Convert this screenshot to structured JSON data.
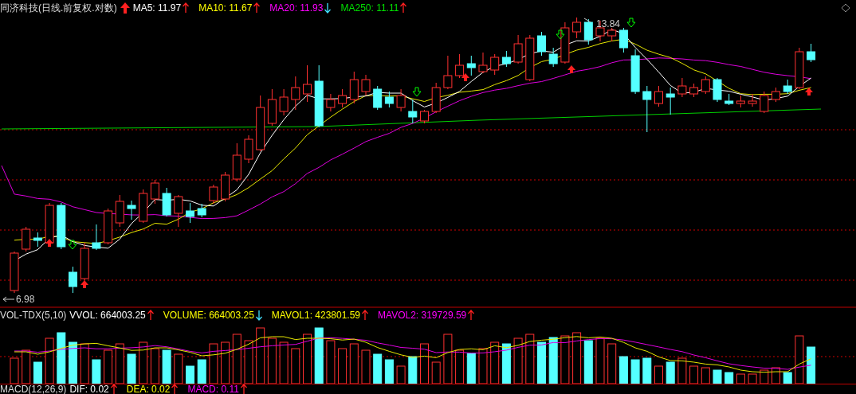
{
  "price_panel": {
    "title": "同济科技(日线.前复权.对数)",
    "title_rising": true,
    "indicators": [
      {
        "label": "MA5: 11.97",
        "color": "#ffffff",
        "rising": true
      },
      {
        "label": "MA10: 11.67",
        "color": "#ffff00",
        "rising": true
      },
      {
        "label": "MA20: 11.93",
        "color": "#ff00ff",
        "rising": false
      },
      {
        "label": "MA250: 11.11",
        "color": "#00e000",
        "rising": true
      }
    ],
    "price_labels": [
      {
        "text": "13.84",
        "kind": "high"
      },
      {
        "text": "6.98",
        "kind": "low"
      }
    ]
  },
  "volume_panel": {
    "title": "VOL-TDX(5,10)",
    "indicators": [
      {
        "label": "VVOL: 664003.25",
        "color": "#ffffff",
        "rising": true
      },
      {
        "label": "VOLUME: 664003.25",
        "color": "#ffff00",
        "rising": false
      },
      {
        "label": "MAVOL1: 423801.59",
        "color": "#ffff00",
        "rising": true
      },
      {
        "label": "MAVOL2: 319729.59",
        "color": "#ff00ff",
        "rising": true
      }
    ]
  },
  "macd_panel": {
    "title": "MACD(12,26,9)",
    "indicators": [
      {
        "label": "DIF: 0.02",
        "color": "#ffffff",
        "rising": true
      },
      {
        "label": "DEA: 0.02",
        "color": "#ffff00",
        "rising": true
      },
      {
        "label": "MACD: 0.11",
        "color": "#ff00ff",
        "rising": true
      }
    ]
  }
}
